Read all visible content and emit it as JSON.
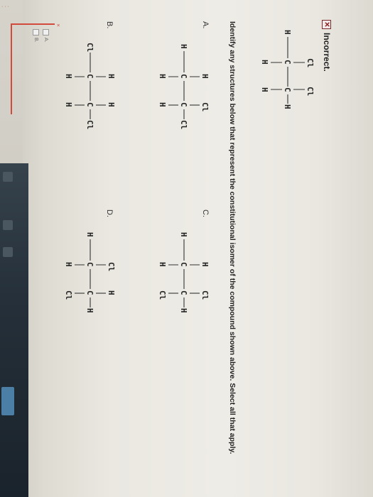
{
  "feedback": {
    "label": "Incorrect."
  },
  "question": {
    "prompt": "Identify any structures below that represent the constitutional isomer of the compound shown above. Select all that apply."
  },
  "options": {
    "A": "A.",
    "B": "B.",
    "C": "C.",
    "D": "D."
  },
  "answer_list": {
    "item_a": "A.",
    "item_b": "B."
  },
  "atoms": {
    "h": "H",
    "c": "C",
    "cl": "Cl"
  },
  "colors": {
    "incorrect_red": "#d24a3c",
    "background": "#eeece6"
  }
}
